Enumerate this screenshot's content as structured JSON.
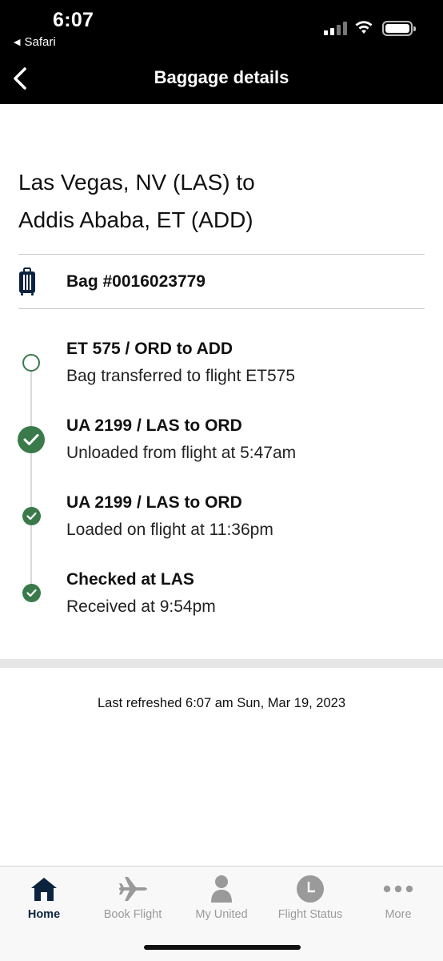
{
  "status_bar": {
    "time": "6:07",
    "back_app": "Safari",
    "back_arrow": "◀"
  },
  "header": {
    "title": "Baggage details",
    "back_icon": "chevron-left-icon"
  },
  "route": {
    "line1": "Las Vegas, NV (LAS) to",
    "line2": "Addis Ababa, ET (ADD)"
  },
  "bag": {
    "label": "Bag #0016023779",
    "icon": "luggage-icon"
  },
  "events": [
    {
      "title": "ET 575 / ORD to ADD",
      "description": "Bag transferred to flight ET575",
      "status": "pending"
    },
    {
      "title": "UA 2199 / LAS to ORD",
      "description": "Unloaded from flight at 5:47am",
      "status": "current"
    },
    {
      "title": "UA 2199 / LAS to ORD",
      "description": "Loaded on flight at 11:36pm",
      "status": "done"
    },
    {
      "title": "Checked at LAS",
      "description": "Received at 9:54pm",
      "status": "done"
    }
  ],
  "last_refreshed": "Last refreshed 6:07 am Sun, Mar 19, 2023",
  "tabbar": {
    "tabs": [
      {
        "label": "Home",
        "icon": "home-icon",
        "active": true
      },
      {
        "label": "Book Flight",
        "icon": "airplane-icon",
        "active": false
      },
      {
        "label": "My United",
        "icon": "person-icon",
        "active": false
      },
      {
        "label": "Flight Status",
        "icon": "clock-icon",
        "active": false
      },
      {
        "label": "More",
        "icon": "more-dots-icon",
        "active": false
      }
    ]
  },
  "colors": {
    "header_bg": "#000000",
    "success_green": "#3a7a4a",
    "navy": "#0c2340",
    "tab_inactive": "#9a9a9a"
  }
}
